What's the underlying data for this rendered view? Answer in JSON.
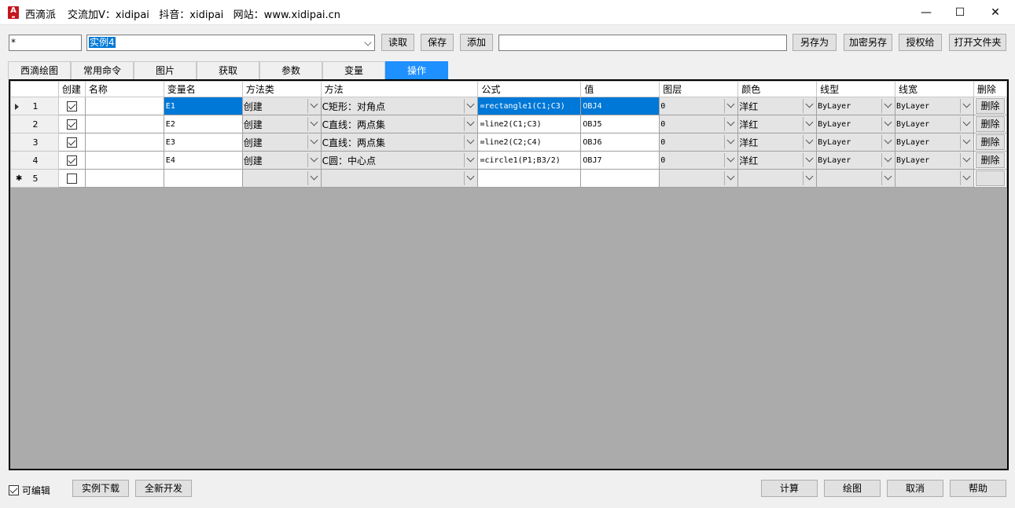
{
  "window": {
    "title": "西滴派",
    "subtitle": "交流加V：xidipai   抖音：xidipai   网站：www.xidipai.cn",
    "icon_letter": "A"
  },
  "toolbar": {
    "filter_value": "*",
    "instance_select": "实例4",
    "read_label": "读取",
    "save_label": "保存",
    "add_label": "添加",
    "path_value": "",
    "save_as_label": "另存为",
    "encrypt_save_label": "加密另存",
    "authorize_label": "授权给",
    "open_folder_label": "打开文件夹"
  },
  "tabs": [
    "西滴绘图",
    "常用命令",
    "图片",
    "获取",
    "参数",
    "变量",
    "操作"
  ],
  "active_tab": "操作",
  "grid": {
    "columns": [
      "创建",
      "名称",
      "变量名",
      "方法类",
      "方法",
      "公式",
      "值",
      "图层",
      "颜色",
      "线型",
      "线宽",
      "删除"
    ],
    "rows": [
      {
        "num": "1",
        "create": true,
        "name": "",
        "var": "E1",
        "method_class": "创建",
        "method": "C矩形：对角点",
        "formula": "=rectangle1(C1;C3)",
        "value": "OBJ4",
        "layer": "0",
        "color": "洋红",
        "linetype": "ByLayer",
        "linewidth": "ByLayer",
        "delete": "删除"
      },
      {
        "num": "2",
        "create": true,
        "name": "",
        "var": "E2",
        "method_class": "创建",
        "method": "C直线：两点集",
        "formula": "=line2(C1;C3)",
        "value": "OBJ5",
        "layer": "0",
        "color": "洋红",
        "linetype": "ByLayer",
        "linewidth": "ByLayer",
        "delete": "删除"
      },
      {
        "num": "3",
        "create": true,
        "name": "",
        "var": "E3",
        "method_class": "创建",
        "method": "C直线：两点集",
        "formula": "=line2(C2;C4)",
        "value": "OBJ6",
        "layer": "0",
        "color": "洋红",
        "linetype": "ByLayer",
        "linewidth": "ByLayer",
        "delete": "删除"
      },
      {
        "num": "4",
        "create": true,
        "name": "",
        "var": "E4",
        "method_class": "创建",
        "method": "C圆：中心点",
        "formula": "=circle1(P1;B3/2)",
        "value": "OBJ7",
        "layer": "0",
        "color": "洋红",
        "linetype": "ByLayer",
        "linewidth": "ByLayer",
        "delete": "删除"
      },
      {
        "num": "5",
        "create": false,
        "name": "",
        "var": "",
        "method_class": "",
        "method": "",
        "formula": "",
        "value": "",
        "layer": "",
        "color": "",
        "linetype": "",
        "linewidth": "",
        "delete": ""
      }
    ]
  },
  "footer": {
    "editable_label": "可编辑",
    "editable_checked": true,
    "download_label": "实例下载",
    "new_dev_label": "全新开发",
    "calc_label": "计算",
    "draw_label": "绘图",
    "cancel_label": "取消",
    "help_label": "帮助"
  }
}
